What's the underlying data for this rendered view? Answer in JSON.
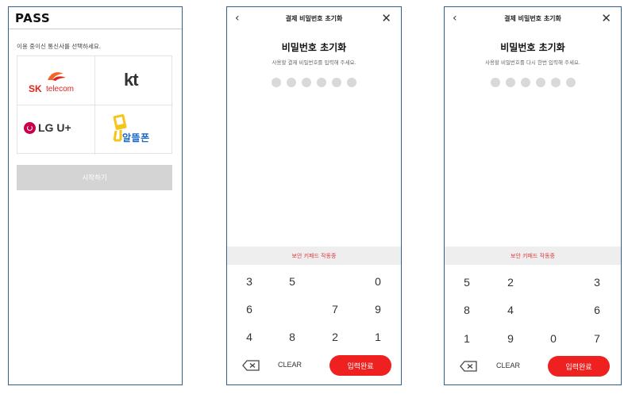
{
  "screen1": {
    "title": "PASS",
    "prompt": "이용 중이신 통신사를 선택하세요.",
    "carriers": {
      "skt": {
        "sk": "SK",
        "telecom": "telecom"
      },
      "kt": "kt",
      "lgu": "LG U+",
      "altteul": "알뜰폰"
    },
    "start_button": "시작하기"
  },
  "screen2": {
    "header_title": "결제 비밀번호 초기화",
    "main_title": "비밀번호 초기화",
    "subtitle": "사용할 결제 비밀번호를 입력해 주세요.",
    "secure_keypad": "보안 키패드 작동중",
    "keys": [
      "3",
      "5",
      "0",
      "6",
      "7",
      "9",
      "4",
      "8",
      "2",
      "1"
    ],
    "clear": "CLEAR",
    "done": "입력완료"
  },
  "screen3": {
    "header_title": "결제 비밀번호 초기화",
    "main_title": "비밀번호 초기화",
    "subtitle": "사용할 비밀번호를 다시 한번 입력해 주세요.",
    "secure_keypad": "보안 키패드 작동중",
    "keys": [
      "5",
      "2",
      "3",
      "8",
      "4",
      "6",
      "1",
      "9",
      "0",
      "7"
    ],
    "clear": "CLEAR",
    "done": "입력완료"
  },
  "colors": {
    "accent": "#ef2020",
    "frame": "#2f5f93",
    "disabled": "#d4d4d4"
  },
  "icons": [
    "back-arrow-icon",
    "close-icon",
    "backspace-icon",
    "sk-telecom-logo",
    "kt-logo",
    "lg-uplus-logo",
    "altteul-logo"
  ]
}
